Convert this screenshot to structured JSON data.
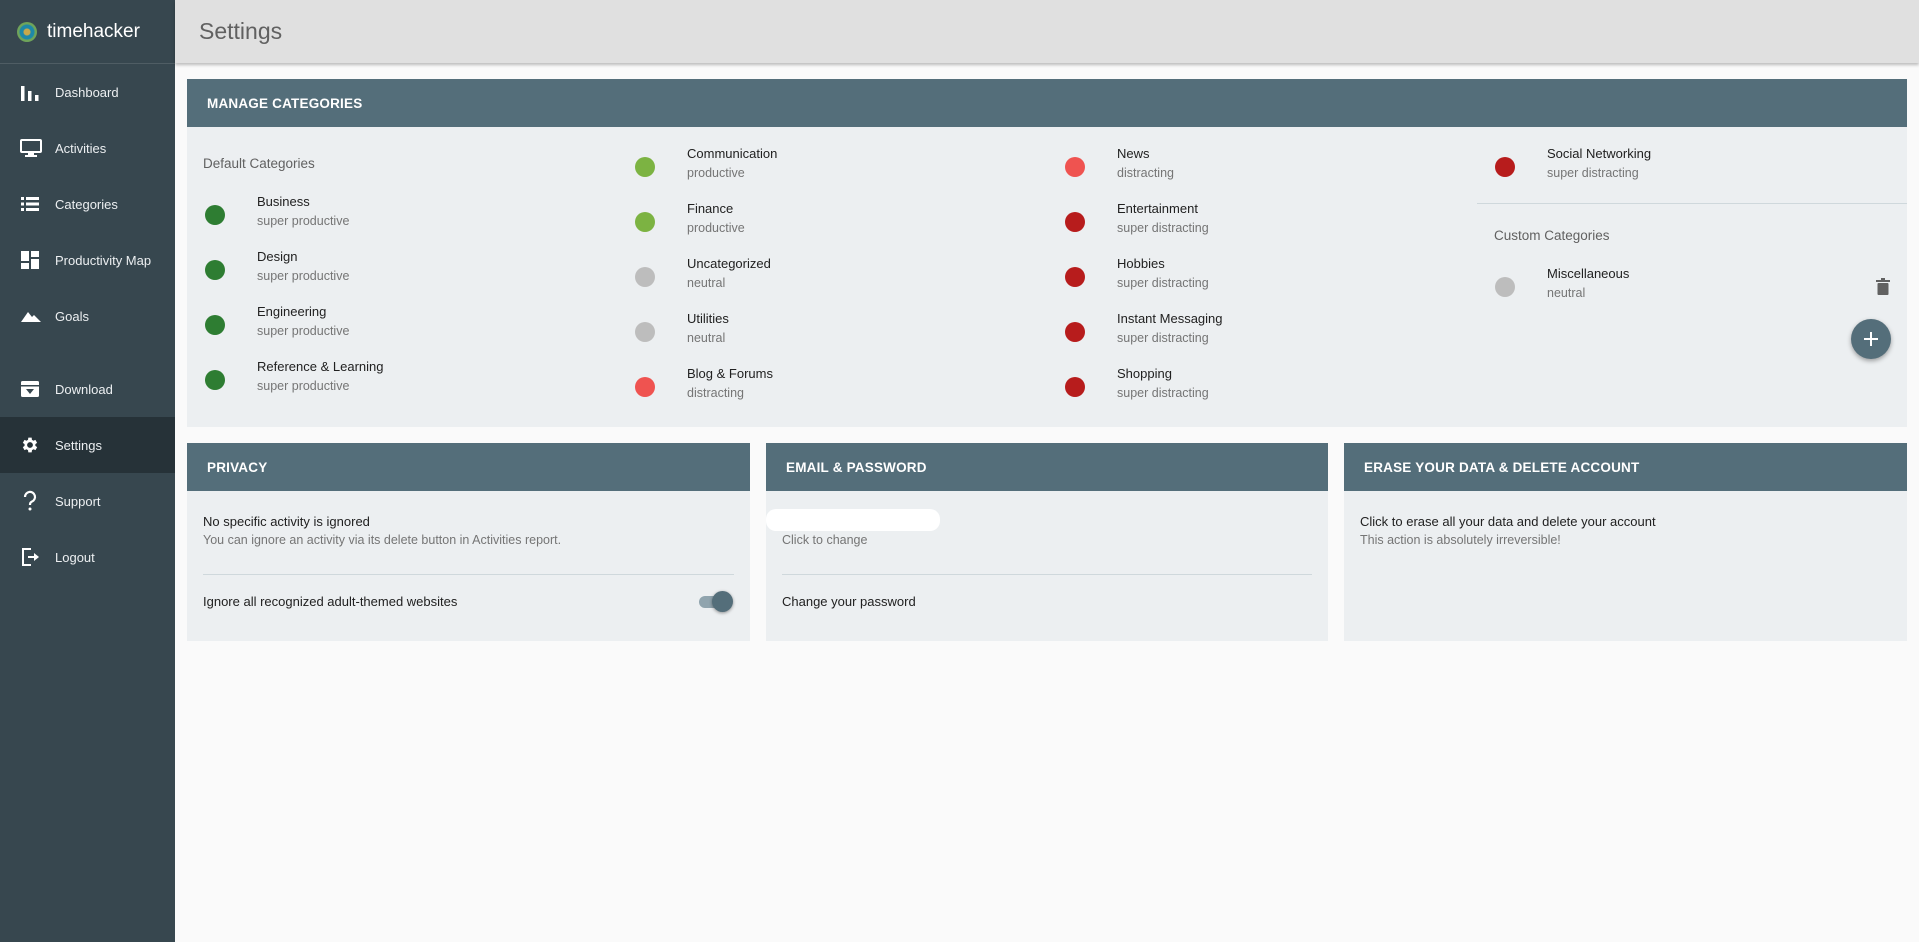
{
  "app": {
    "name": "timehacker"
  },
  "sidebar": {
    "items": [
      {
        "label": "Dashboard",
        "icon": "bar-chart-icon"
      },
      {
        "label": "Activities",
        "icon": "monitor-icon"
      },
      {
        "label": "Categories",
        "icon": "list-icon"
      },
      {
        "label": "Productivity Map",
        "icon": "dashboard-grid-icon"
      },
      {
        "label": "Goals",
        "icon": "mountain-icon"
      },
      {
        "label": "Download",
        "icon": "archive-download-icon"
      },
      {
        "label": "Settings",
        "icon": "gear-icon",
        "active": true
      },
      {
        "label": "Support",
        "icon": "question-mark-icon"
      },
      {
        "label": "Logout",
        "icon": "logout-icon"
      }
    ]
  },
  "header": {
    "title": "Settings"
  },
  "colors": {
    "super_productive": "#2e7d32",
    "productive": "#7cb342",
    "neutral": "#bdbdbd",
    "distracting": "#ef5350",
    "super_distracting": "#b71c1c",
    "sidebar": "#37474f",
    "panel_header": "#546e7a"
  },
  "manage_categories": {
    "title": "MANAGE CATEGORIES",
    "default_label": "Default Categories",
    "custom_label": "Custom Categories",
    "columns": [
      [
        {
          "name": "Business",
          "level": "super productive",
          "color": "#2e7d32"
        },
        {
          "name": "Design",
          "level": "super productive",
          "color": "#2e7d32"
        },
        {
          "name": "Engineering",
          "level": "super productive",
          "color": "#2e7d32"
        },
        {
          "name": "Reference & Learning",
          "level": "super productive",
          "color": "#2e7d32"
        }
      ],
      [
        {
          "name": "Communication",
          "level": "productive",
          "color": "#7cb342"
        },
        {
          "name": "Finance",
          "level": "productive",
          "color": "#7cb342"
        },
        {
          "name": "Uncategorized",
          "level": "neutral",
          "color": "#bdbdbd"
        },
        {
          "name": "Utilities",
          "level": "neutral",
          "color": "#bdbdbd"
        },
        {
          "name": "Blog & Forums",
          "level": "distracting",
          "color": "#ef5350"
        }
      ],
      [
        {
          "name": "News",
          "level": "distracting",
          "color": "#ef5350"
        },
        {
          "name": "Entertainment",
          "level": "super distracting",
          "color": "#b71c1c"
        },
        {
          "name": "Hobbies",
          "level": "super distracting",
          "color": "#b71c1c"
        },
        {
          "name": "Instant Messaging",
          "level": "super distracting",
          "color": "#b71c1c"
        },
        {
          "name": "Shopping",
          "level": "super distracting",
          "color": "#b71c1c"
        }
      ],
      [
        {
          "name": "Social Networking",
          "level": "super distracting",
          "color": "#b71c1c"
        }
      ]
    ],
    "custom": [
      {
        "name": "Miscellaneous",
        "level": "neutral",
        "color": "#bdbdbd"
      }
    ]
  },
  "privacy": {
    "title": "PRIVACY",
    "status": "No specific activity is ignored",
    "hint": "You can ignore an activity via its delete button in Activities report.",
    "adult_label": "Ignore all recognized adult-themed websites",
    "adult_toggle_on": true
  },
  "email_password": {
    "title": "EMAIL & PASSWORD",
    "email_hint": "Click to change",
    "password_label": "Change your password"
  },
  "erase": {
    "title": "ERASE YOUR DATA & DELETE ACCOUNT",
    "action": "Click to erase all your data and delete your account",
    "warning": "This action is absolutely irreversible!"
  }
}
